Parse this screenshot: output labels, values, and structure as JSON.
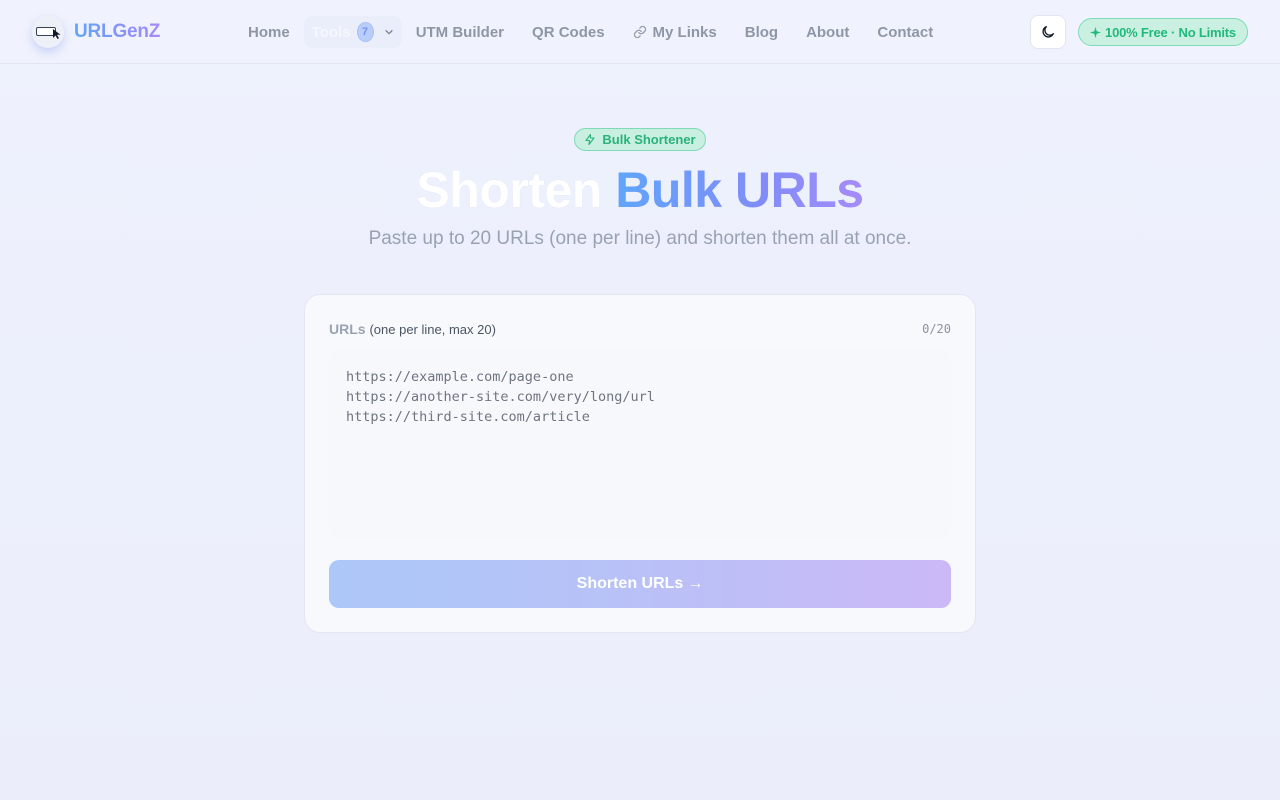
{
  "header": {
    "brand": "URLGenZ",
    "nav": {
      "home": "Home",
      "tools": "Tools",
      "tools_count": "7",
      "utm": "UTM Builder",
      "qr": "QR Codes",
      "my_links": "My Links",
      "blog": "Blog",
      "about": "About",
      "contact": "Contact"
    },
    "free_badge": "100% Free · No Limits"
  },
  "hero": {
    "badge": "Bulk Shortener",
    "title_plain": "Shorten",
    "title_gradient": "Bulk URLs",
    "subtitle": "Paste up to 20 URLs (one per line) and shorten them all at once."
  },
  "form": {
    "label": "URLs",
    "label_hint": "(one per line, max 20)",
    "counter": "0/20",
    "placeholder": "https://example.com/page-one\nhttps://another-site.com/very/long/url\nhttps://third-site.com/article",
    "submit": "Shorten URLs",
    "submit_arrow": "→"
  },
  "colors": {
    "brand_blue": "#60a5fa",
    "brand_violet": "#a78bfa",
    "success_green": "#22b97c"
  },
  "icons": [
    "logo-icon",
    "chevron-down-icon",
    "link-icon",
    "moon-icon",
    "sparkle-icon",
    "bolt-icon",
    "arrow-right-icon"
  ]
}
